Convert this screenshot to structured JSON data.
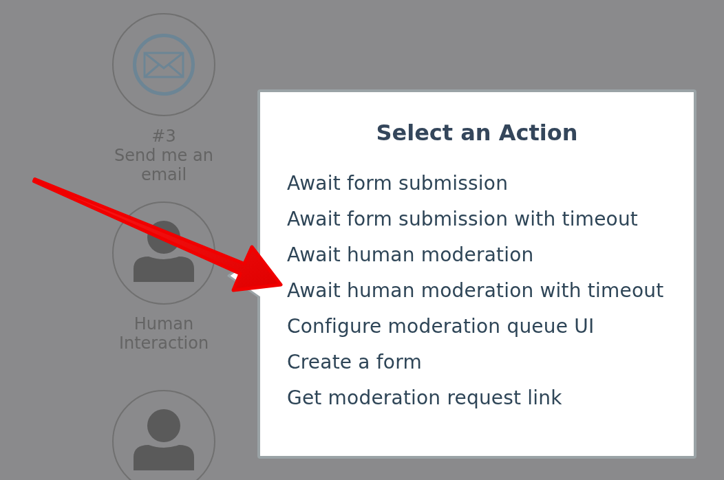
{
  "nodes": [
    {
      "kind": "email",
      "number": "#3",
      "label": "Send me an email"
    },
    {
      "kind": "person",
      "label": "Human Interaction"
    },
    {
      "kind": "person"
    }
  ],
  "dialog": {
    "title": "Select an Action",
    "actions": [
      "Await form submission",
      "Await form submission with timeout",
      "Await human moderation",
      "Await human moderation with timeout",
      "Configure moderation queue UI",
      "Create a form",
      "Get moderation request link"
    ]
  },
  "annotations": [
    {
      "kind": "arrow"
    }
  ]
}
